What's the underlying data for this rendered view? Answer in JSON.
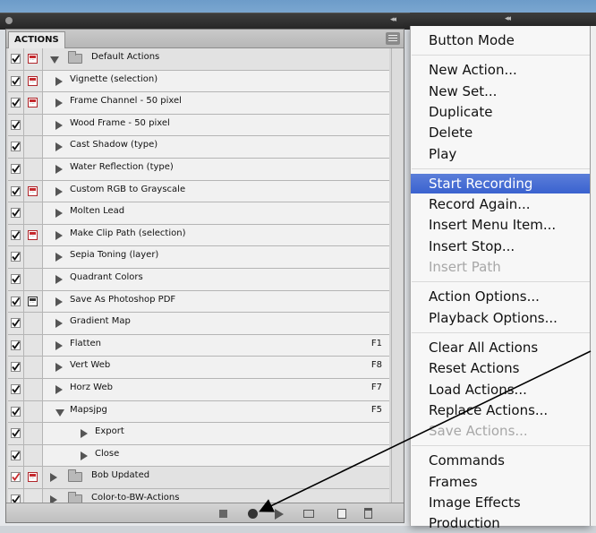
{
  "panel": {
    "tab_label": "ACTIONS",
    "rows": [
      {
        "kind": "set",
        "label": "Default Actions",
        "checked": true,
        "dialog": "red",
        "expanded": true,
        "indent": 1,
        "key": ""
      },
      {
        "kind": "action",
        "label": "Vignette (selection)",
        "checked": true,
        "dialog": "red",
        "expanded": false,
        "indent": 1,
        "key": ""
      },
      {
        "kind": "action",
        "label": "Frame Channel - 50 pixel",
        "checked": true,
        "dialog": "red",
        "expanded": false,
        "indent": 1,
        "key": ""
      },
      {
        "kind": "action",
        "label": "Wood Frame - 50 pixel",
        "checked": true,
        "dialog": "none",
        "expanded": false,
        "indent": 1,
        "key": ""
      },
      {
        "kind": "action",
        "label": "Cast Shadow (type)",
        "checked": true,
        "dialog": "none",
        "expanded": false,
        "indent": 1,
        "key": ""
      },
      {
        "kind": "action",
        "label": "Water Reflection (type)",
        "checked": true,
        "dialog": "none",
        "expanded": false,
        "indent": 1,
        "key": ""
      },
      {
        "kind": "action",
        "label": "Custom RGB to Grayscale",
        "checked": true,
        "dialog": "red",
        "expanded": false,
        "indent": 1,
        "key": ""
      },
      {
        "kind": "action",
        "label": "Molten Lead",
        "checked": true,
        "dialog": "none",
        "expanded": false,
        "indent": 1,
        "key": ""
      },
      {
        "kind": "action",
        "label": "Make Clip Path (selection)",
        "checked": true,
        "dialog": "red",
        "expanded": false,
        "indent": 1,
        "key": ""
      },
      {
        "kind": "action",
        "label": "Sepia Toning (layer)",
        "checked": true,
        "dialog": "none",
        "expanded": false,
        "indent": 1,
        "key": ""
      },
      {
        "kind": "action",
        "label": "Quadrant Colors",
        "checked": true,
        "dialog": "none",
        "expanded": false,
        "indent": 1,
        "key": ""
      },
      {
        "kind": "action",
        "label": "Save As Photoshop PDF",
        "checked": true,
        "dialog": "black",
        "expanded": false,
        "indent": 1,
        "key": ""
      },
      {
        "kind": "action",
        "label": "Gradient Map",
        "checked": true,
        "dialog": "none",
        "expanded": false,
        "indent": 1,
        "key": ""
      },
      {
        "kind": "action",
        "label": "Flatten",
        "checked": true,
        "dialog": "none",
        "expanded": false,
        "indent": 1,
        "key": "F1"
      },
      {
        "kind": "action",
        "label": "Vert Web",
        "checked": true,
        "dialog": "none",
        "expanded": false,
        "indent": 1,
        "key": "F8"
      },
      {
        "kind": "action",
        "label": "Horz Web",
        "checked": true,
        "dialog": "none",
        "expanded": false,
        "indent": 1,
        "key": "F7"
      },
      {
        "kind": "action",
        "label": "Mapsjpg",
        "checked": true,
        "dialog": "none",
        "expanded": true,
        "indent": 1,
        "key": "F5"
      },
      {
        "kind": "step",
        "label": "Export",
        "checked": true,
        "dialog": "none",
        "expanded": false,
        "indent": 2,
        "key": ""
      },
      {
        "kind": "step",
        "label": "Close",
        "checked": true,
        "dialog": "none",
        "expanded": false,
        "indent": 2,
        "key": ""
      },
      {
        "kind": "set",
        "label": "Bob Updated",
        "checked": true,
        "check_color": "#c52a2e",
        "dialog": "red",
        "expanded": false,
        "indent": 1,
        "key": ""
      },
      {
        "kind": "set",
        "label": "Color-to-BW-Actions",
        "checked": true,
        "dialog": "none",
        "expanded": false,
        "indent": 1,
        "key": ""
      }
    ]
  },
  "menu": {
    "items": [
      {
        "label": "Button Mode",
        "state": "normal",
        "sep_after": true
      },
      {
        "label": "New Action...",
        "state": "normal",
        "sep_after": false
      },
      {
        "label": "New Set...",
        "state": "normal",
        "sep_after": false
      },
      {
        "label": "Duplicate",
        "state": "normal",
        "sep_after": false
      },
      {
        "label": "Delete",
        "state": "normal",
        "sep_after": false
      },
      {
        "label": "Play",
        "state": "normal",
        "sep_after": true
      },
      {
        "label": "Start Recording",
        "state": "highlighted",
        "sep_after": false
      },
      {
        "label": "Record Again...",
        "state": "normal",
        "sep_after": false
      },
      {
        "label": "Insert Menu Item...",
        "state": "normal",
        "sep_after": false
      },
      {
        "label": "Insert Stop...",
        "state": "normal",
        "sep_after": false
      },
      {
        "label": "Insert Path",
        "state": "disabled",
        "sep_after": true
      },
      {
        "label": "Action Options...",
        "state": "normal",
        "sep_after": false
      },
      {
        "label": "Playback Options...",
        "state": "normal",
        "sep_after": true
      },
      {
        "label": "Clear All Actions",
        "state": "normal",
        "sep_after": false
      },
      {
        "label": "Reset Actions",
        "state": "normal",
        "sep_after": false
      },
      {
        "label": "Load Actions...",
        "state": "normal",
        "sep_after": false
      },
      {
        "label": "Replace Actions...",
        "state": "normal",
        "sep_after": false
      },
      {
        "label": "Save Actions...",
        "state": "disabled",
        "sep_after": true
      },
      {
        "label": "Commands",
        "state": "normal",
        "sep_after": false
      },
      {
        "label": "Frames",
        "state": "normal",
        "sep_after": false
      },
      {
        "label": "Image Effects",
        "state": "normal",
        "sep_after": false
      },
      {
        "label": "Production",
        "state": "normal",
        "sep_after": false
      }
    ]
  },
  "bottom_bar": {
    "buttons": [
      {
        "name": "stop-button",
        "icon": "stop-icon"
      },
      {
        "name": "record-button",
        "icon": "record-icon"
      },
      {
        "name": "play-button",
        "icon": "play-icon"
      },
      {
        "name": "new-set-button",
        "icon": "folder-icon"
      },
      {
        "name": "new-action-button",
        "icon": "new-item-icon"
      },
      {
        "name": "delete-button",
        "icon": "trash-icon"
      }
    ]
  },
  "colors": {
    "highlight": "#3a62cf",
    "dialog_red": "#c52a2e",
    "panel_bg": "#d6d6d6"
  }
}
